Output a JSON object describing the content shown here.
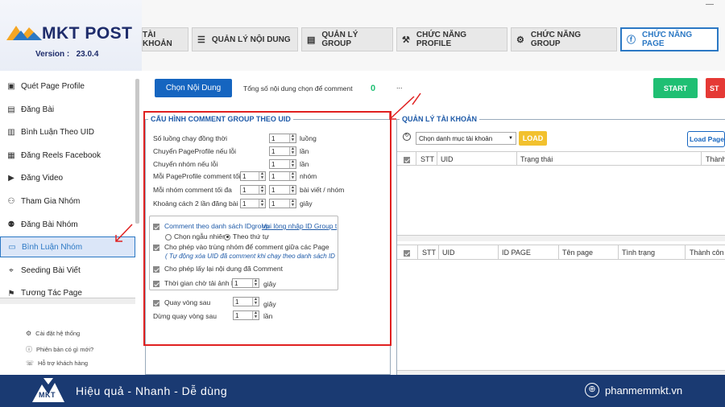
{
  "app": {
    "name": "MKT POST",
    "version_label": "Version :",
    "version": "23.0.4"
  },
  "sidebar": {
    "items": [
      {
        "label": "Quét Page Profile",
        "icon": "scan-icon"
      },
      {
        "label": "Đăng Bài",
        "icon": "post-icon"
      },
      {
        "label": "Bình Luận Theo UID",
        "icon": "comment-icon"
      },
      {
        "label": "Đăng Reels Facebook",
        "icon": "reels-icon"
      },
      {
        "label": "Đăng Video",
        "icon": "video-icon"
      },
      {
        "label": "Tham Gia Nhóm",
        "icon": "group-icon"
      },
      {
        "label": "Đăng Bài Nhóm",
        "icon": "group-post-icon"
      },
      {
        "label": "Bình Luận Nhóm",
        "icon": "chat-icon"
      },
      {
        "label": "Seeding Bài Viết",
        "icon": "seeding-icon"
      },
      {
        "label": "Tương Tác Page",
        "icon": "interact-icon"
      }
    ],
    "active_index": 7,
    "bottom_links": [
      "Cài đặt hệ thống",
      "Phiên bản có gì mới?",
      "Hỗ trợ khách hàng"
    ]
  },
  "tabs": [
    {
      "label": "TÀI KHOẢN",
      "icon": ""
    },
    {
      "label": "QUẢN LÝ NỘI DUNG",
      "icon": "list-icon"
    },
    {
      "label": "QUẢN LÝ GROUP",
      "icon": "table-icon"
    },
    {
      "label": "CHỨC NĂNG PROFILE",
      "icon": "tool-icon"
    },
    {
      "label": "CHỨC NĂNG GROUP",
      "icon": "gear-icon"
    },
    {
      "label": "CHỨC NĂNG PAGE",
      "icon": "page-icon"
    }
  ],
  "window": {
    "minimize": "—"
  },
  "toolbar": {
    "choose_content": "Chọn Nội Dung",
    "total_label": "Tổng số nội dung chọn để comment",
    "total_value": "0",
    "ellipsis": "...",
    "start": "START",
    "stop": "ST"
  },
  "config": {
    "title": "CẤU HÌNH COMMENT GROUP THEO UID",
    "rows": [
      {
        "label": "Số luồng chạy đồng thời",
        "value": "1",
        "unit": "luồng"
      },
      {
        "label": "Chuyển PageProfile nếu lỗi",
        "value": "1",
        "unit": "lần"
      },
      {
        "label": "Chuyển nhóm nếu lỗi",
        "value": "1",
        "unit": "lần"
      },
      {
        "label": "Mỗi PageProfile comment tối đa",
        "value_from": "1",
        "value_to": "1",
        "unit": "nhóm"
      },
      {
        "label": "Mỗi nhóm comment tối đa",
        "value_from": "1",
        "value_to": "1",
        "unit": "bài viết / nhóm"
      },
      {
        "label": "Khoảng cách 2 lần đăng bài",
        "value_from": "1",
        "value_to": "1",
        "unit": "giây"
      }
    ],
    "options": {
      "uid_list_label": "Comment theo danh sách IDgroup",
      "uid_list_link": "Vui lòng nhập ID Group t",
      "random_label": "Chọn ngẫu nhiên",
      "order_label": "Theo thứ tự",
      "allow_same_group": "Cho phép vào trùng nhóm để comment giữa các Page",
      "auto_remove_note": "( Tự động xóa UID đã comment khi chạy theo danh sách ID",
      "allow_repeat": "Cho phép lấy lại nội dung đã Comment",
      "wait_image": "Thời gian chờ tải ảnh lên",
      "wait_image_value": "1",
      "wait_image_unit": "giây",
      "loop_label": "Quay vòng sau",
      "loop_value": "1",
      "loop_unit": "giây",
      "stop_loop_label": "Dừng quay vòng sau",
      "stop_loop_value": "1",
      "stop_loop_unit": "lần"
    }
  },
  "accounts": {
    "title": "QUẢN LÝ TÀI KHOẢN",
    "category_placeholder": "Chọn danh mục tài khoản",
    "load_button": "LOAD",
    "load_page_button": "Load Page",
    "table1_headers": [
      "STT",
      "UID",
      "Trạng thái",
      "Thành"
    ],
    "table2_headers": [
      "STT",
      "UID",
      "ID PAGE",
      "Tên page",
      "Tình trạng",
      "Thành côn"
    ]
  },
  "footer": {
    "logo": "MKT",
    "slogan": "Hiệu quả - Nhanh - Dễ dùng",
    "website": "phanmemmkt.vn"
  }
}
